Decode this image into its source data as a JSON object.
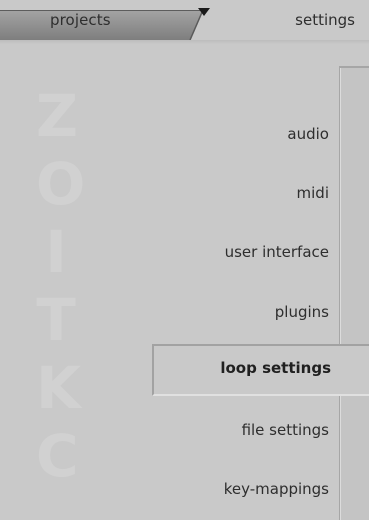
{
  "tabs": {
    "projects_label": "projects",
    "settings_label": "settings",
    "active": "settings"
  },
  "brand": {
    "letters": [
      "Z",
      "O",
      "I",
      "T",
      "K",
      "C"
    ]
  },
  "menu": {
    "items": [
      {
        "label": "audio"
      },
      {
        "label": "midi"
      },
      {
        "label": "user interface"
      },
      {
        "label": "plugins"
      },
      {
        "label": "loop settings",
        "selected": true
      },
      {
        "label": "file settings"
      },
      {
        "label": "key-mappings"
      }
    ]
  },
  "colors": {
    "background": "#c9c9c9",
    "projects_tab": "#8f8f8f",
    "text": "#2e2e2e",
    "watermark": "#d1d1d1"
  }
}
